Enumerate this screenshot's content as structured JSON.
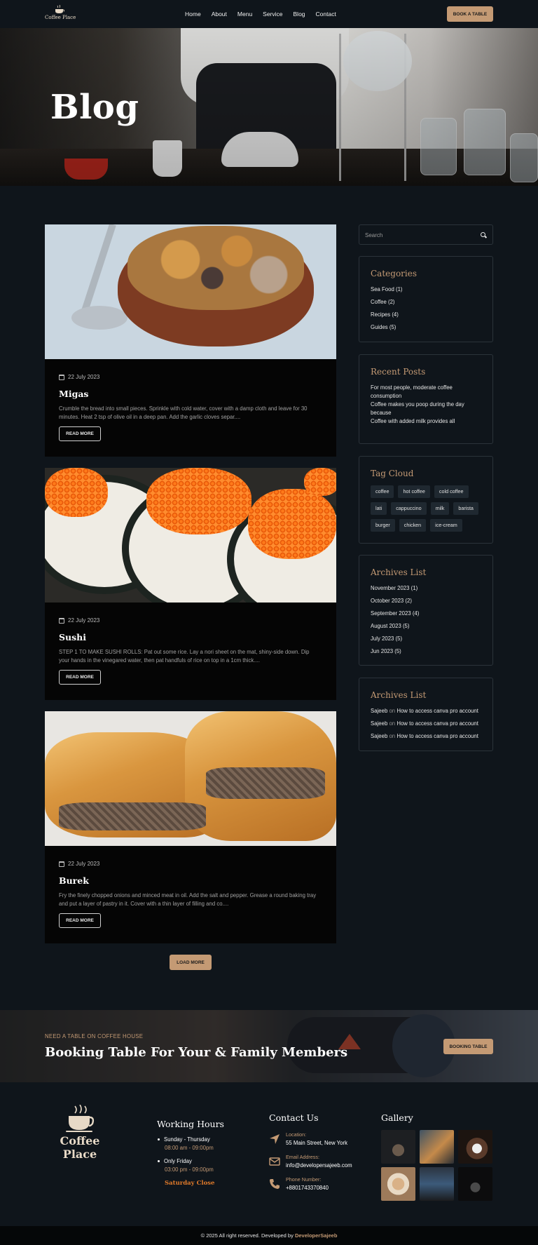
{
  "nav": {
    "brand": "Coffee Place",
    "menu": [
      "Home",
      "About",
      "Menu",
      "Service",
      "Blog",
      "Contact"
    ],
    "cta": "BOOK A TABLE"
  },
  "hero": {
    "title": "Blog"
  },
  "posts": [
    {
      "date": "22 July 2023",
      "title": "Migas",
      "excerpt": "Crumble the bread into small pieces. Sprinkle with cold water, cover with a damp cloth and leave for 30 minutes. Heat 2 tsp of olive oil in a deep pan. Add the garlic cloves separ....",
      "button": "READ MORE"
    },
    {
      "date": "22 July 2023",
      "title": "Sushi",
      "excerpt": "STEP 1 TO MAKE SUSHI ROLLS: Pat out some rice. Lay a nori sheet on the mat, shiny-side down. Dip your hands in the vinegared water, then pat handfuls of rice on top in a 1cm thick....",
      "button": "READ MORE"
    },
    {
      "date": "22 July 2023",
      "title": "Burek",
      "excerpt": "Fry the finely chopped onions and minced meat in oil. Add the salt and pepper. Grease a round baking tray and put a layer of pastry in it. Cover with a thin layer of filling and co....",
      "button": "READ MORE"
    }
  ],
  "load_more": "LOAD MORE",
  "sidebar": {
    "search_placeholder": "Search",
    "categories": {
      "title": "Categories",
      "items": [
        "Sea Food (1)",
        "Coffee (2)",
        "Recipes (4)",
        "Guides (5)"
      ]
    },
    "recent": {
      "title": "Recent Posts",
      "items": [
        "For most people, moderate coffee consumption",
        "Coffee makes you poop during the day because",
        "Coffee with added milk provides all"
      ]
    },
    "tags": {
      "title": "Tag Cloud",
      "items": [
        "coffee",
        "hot coffee",
        "cold coffee",
        "lati",
        "cappuccino",
        "milk",
        "barista",
        "burger",
        "chicken",
        "ice-cream"
      ]
    },
    "archives": {
      "title": "Archives List",
      "items": [
        "November 2023 (1)",
        "October 2023 (2)",
        "September 2023 (4)",
        "August 2023 (5)",
        "July 2023 (5)",
        "Jun 2023 (5)"
      ]
    },
    "comments": {
      "title": "Archives List",
      "items": [
        {
          "author": "Sajeeb",
          "on": "on",
          "post": "How to access canva pro account"
        },
        {
          "author": "Sajeeb",
          "on": "on",
          "post": "How to access canva pro account"
        },
        {
          "author": "Sajeeb",
          "on": "on",
          "post": "How to access canva pro account"
        }
      ]
    }
  },
  "banner": {
    "kicker": "NEED A TABLE ON COFFEE HOUSE",
    "title": "Booking Table For Your & Family Members",
    "button": "BOOKING TABLE"
  },
  "footer": {
    "brand": "Coffee Place",
    "hours": {
      "title": "Working Hours",
      "rows": [
        {
          "day": "Sunday - Thursday",
          "time": "08:00 am - 09:00pm"
        },
        {
          "day": "Only Friday",
          "time": "03:00 pm - 09:00pm"
        }
      ],
      "closed": "Saturday Close"
    },
    "contact": {
      "title": "Contact Us",
      "location_label": "Location:",
      "location": "55 Main Street, New York",
      "email_label": "Email Address:",
      "email": "info@developersajeeb.com",
      "phone_label": "Phone Number:",
      "phone": "+8801743370840"
    },
    "gallery_title": "Gallery",
    "copyright": "© 2025 All right reserved. Developed by",
    "developer": "DeveloperSajeeb"
  },
  "colors": {
    "accent": "#c49a74",
    "background": "#0f151b",
    "card": "#050505"
  }
}
